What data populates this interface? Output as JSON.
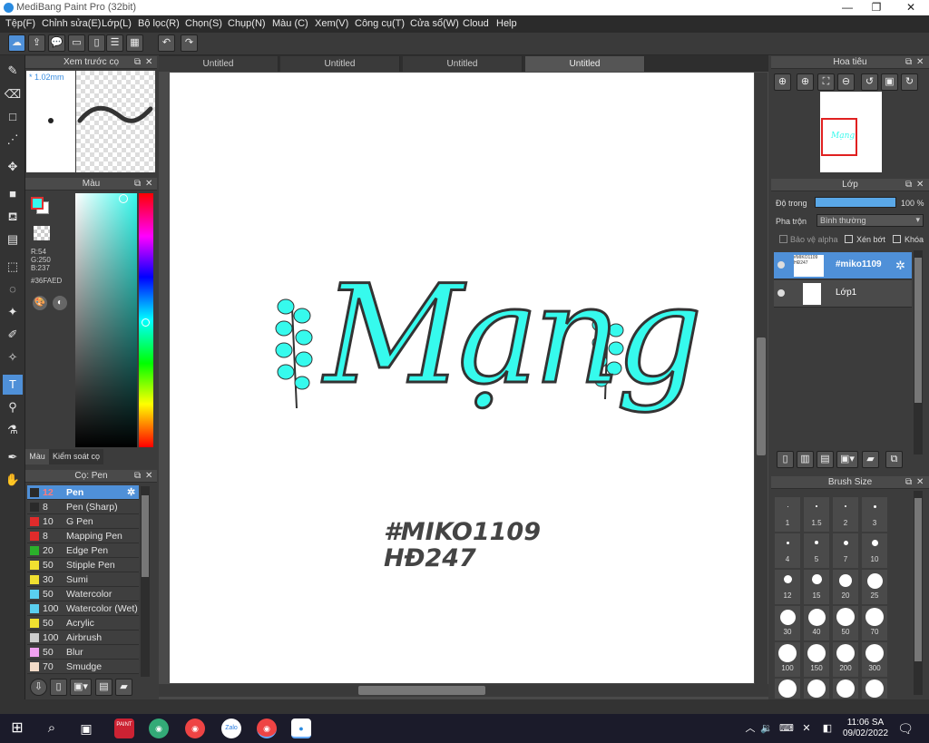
{
  "window": {
    "title": "MediBang Paint Pro (32bit)",
    "minimize": "—",
    "restore": "❐",
    "close": "✕"
  },
  "menu": [
    "Tệp(F)",
    "Chỉnh sửa(E)",
    "Lớp(L)",
    "Bộ lọc(R)",
    "Chọn(S)",
    "Chụp(N)",
    "Màu (C)",
    "Xem(V)",
    "Công cụ(T)",
    "Cửa sổ(W)",
    "Cloud",
    "Help"
  ],
  "brush_preview": {
    "title": "Xem trước cọ",
    "size": "* 1.02mm"
  },
  "color_panel": {
    "title": "Màu",
    "r": "R:54",
    "g": "G:250",
    "b": "B:237",
    "hex": "#36FAED",
    "fg_color": "#36faed",
    "tab_color": "Màu",
    "tab_brush": "Kiểm soát cọ"
  },
  "brush_panel": {
    "title": "Cọ: Pen",
    "items": [
      {
        "size": "12",
        "name": "Pen",
        "color": "#2a2a2a",
        "selected": true
      },
      {
        "size": "8",
        "name": "Pen (Sharp)",
        "color": "#2a2a2a"
      },
      {
        "size": "10",
        "name": "G Pen",
        "color": "#e02b2b"
      },
      {
        "size": "8",
        "name": "Mapping Pen",
        "color": "#e02b2b"
      },
      {
        "size": "20",
        "name": "Edge Pen",
        "color": "#2bb02b"
      },
      {
        "size": "50",
        "name": "Stipple Pen",
        "color": "#f0e030"
      },
      {
        "size": "30",
        "name": "Sumi",
        "color": "#f0e030"
      },
      {
        "size": "50",
        "name": "Watercolor",
        "color": "#5ad0f0"
      },
      {
        "size": "100",
        "name": "Watercolor (Wet)",
        "color": "#5ad0f0"
      },
      {
        "size": "50",
        "name": "Acrylic",
        "color": "#f0e030"
      },
      {
        "size": "100",
        "name": "Airbrush",
        "color": "#cccccc"
      },
      {
        "size": "50",
        "name": "Blur",
        "color": "#f0a0f0"
      },
      {
        "size": "70",
        "name": "Smudge",
        "color": "#f3dcc8"
      }
    ]
  },
  "tabs": [
    "Untitled",
    "Untitled",
    "Untitled",
    "Untitled"
  ],
  "canvas": {
    "main_word": "Mạng",
    "tag_line1": "#MIKO1109",
    "tag_line2": "HĐ247",
    "accent": "#36faed"
  },
  "navigator": {
    "title": "Hoa tiêu"
  },
  "layers": {
    "title": "Lớp",
    "opacity_label": "Độ trong",
    "opacity_value": "100 %",
    "blend_label": "Pha trộn",
    "blend_value": "Bình thường",
    "protect_alpha": "Bảo vệ alpha",
    "clipping": "Xén bớt",
    "lock": "Khóa",
    "items": [
      {
        "name": "#miko1109",
        "selected": true,
        "thumb": "#MIKO1109 HĐ247"
      },
      {
        "name": "Lớp1",
        "selected": false
      }
    ]
  },
  "brush_size": {
    "title": "Brush Size",
    "values": [
      "1",
      "1.5",
      "2",
      "3",
      "4",
      "5",
      "7",
      "10",
      "12",
      "15",
      "20",
      "25",
      "30",
      "40",
      "50",
      "70",
      "100",
      "150",
      "200",
      "300"
    ]
  },
  "taskbar": {
    "time": "11:06 SA",
    "date": "09/02/2022",
    "zalo": "Zalo",
    "paint_label": "PAINT"
  }
}
